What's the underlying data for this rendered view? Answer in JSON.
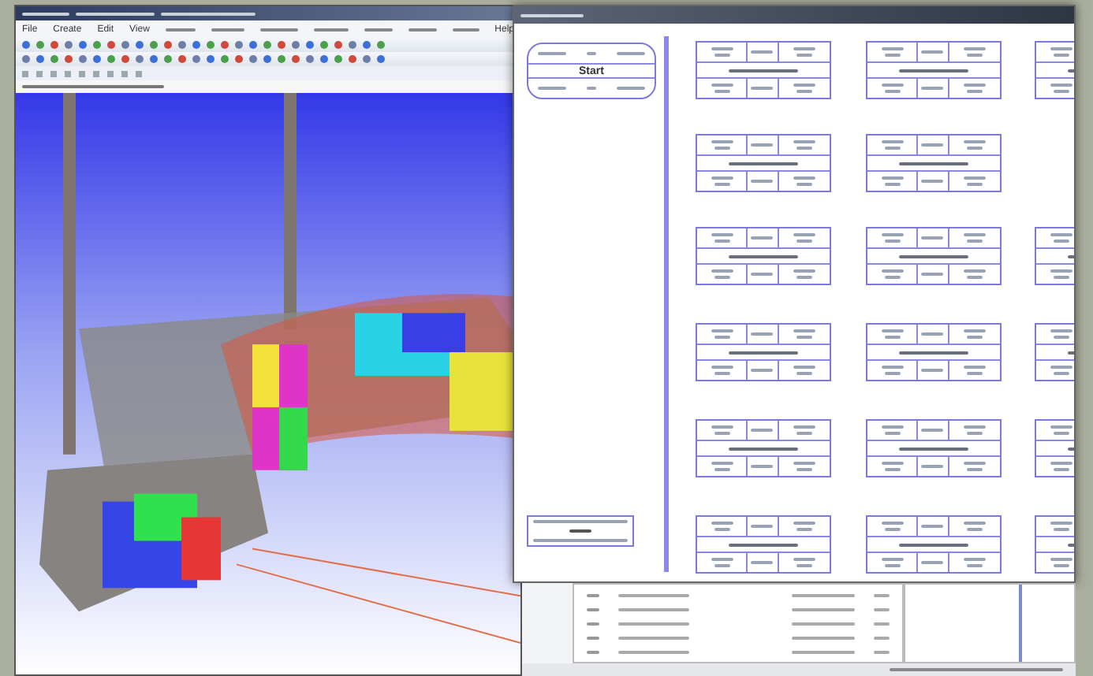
{
  "main_window": {
    "menu": [
      {
        "label": "File"
      },
      {
        "label": "Create"
      },
      {
        "label": "Edit"
      },
      {
        "label": "View"
      }
    ],
    "last_menu": {
      "label": "Help"
    }
  },
  "network_window": {
    "start_node": {
      "label": "Start"
    }
  }
}
